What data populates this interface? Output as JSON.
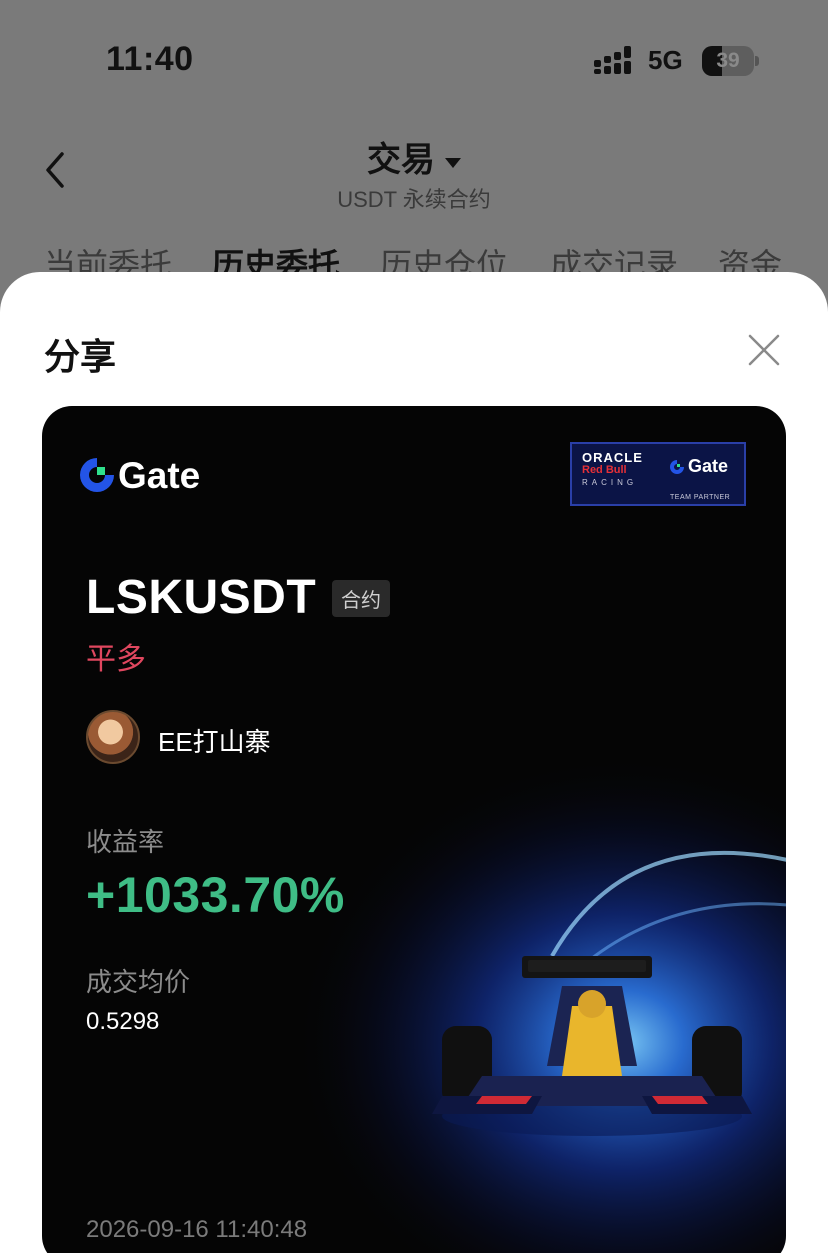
{
  "status_bar": {
    "time": "11:40",
    "network": "5G",
    "battery_percent": "39",
    "battery_level": 0.39
  },
  "header": {
    "title": "交易",
    "subtitle": "USDT 永续合约"
  },
  "tabs": [
    {
      "label": "当前委托",
      "active": false
    },
    {
      "label": "历史委托",
      "active": true
    },
    {
      "label": "历史仓位",
      "active": false
    },
    {
      "label": "成交记录",
      "active": false
    },
    {
      "label": "资金",
      "active": false
    }
  ],
  "share_sheet": {
    "title": "分享",
    "card": {
      "brand": "Gate",
      "partner": {
        "line1": "ORACLE",
        "line2": "Red Bull",
        "line3": "RACING",
        "brand": "Gate",
        "tagline": "TEAM PARTNER"
      },
      "pair": "LSKUSDT",
      "contract_tag": "合约",
      "side": "平多",
      "username": "EE打山寨",
      "roi_label": "收益率",
      "roi_value": "+1033.70%",
      "avg_price_label": "成交均价",
      "avg_price_value": "0.5298",
      "timestamp": "2026-09-16 11:40:48"
    }
  },
  "colors": {
    "accent_green": "#3fbd86",
    "side_red": "#e0475f",
    "gate_blue": "#2354e6",
    "gate_green": "#2fe08d"
  }
}
